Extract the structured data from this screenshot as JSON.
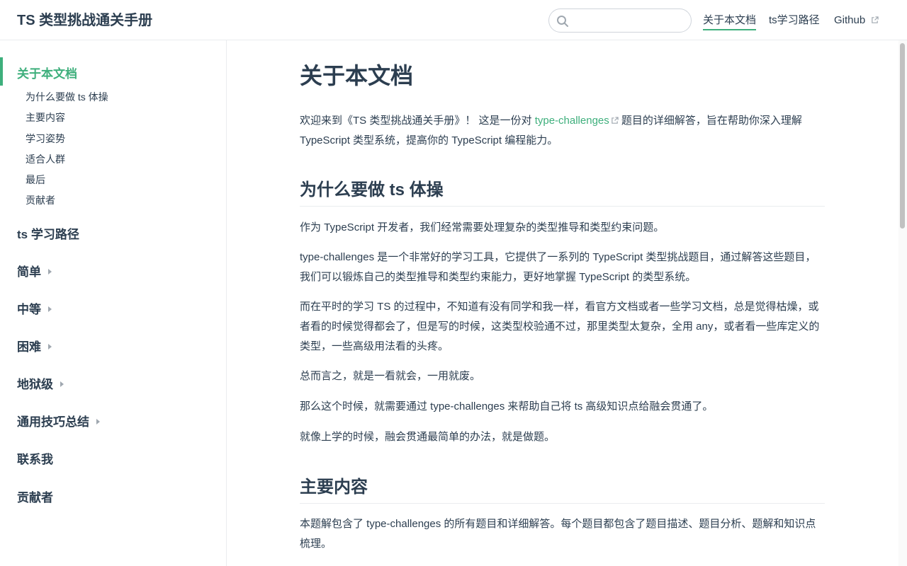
{
  "navbar": {
    "site_title": "TS 类型挑战通关手册",
    "search": {
      "value": "",
      "placeholder": ""
    },
    "links": [
      {
        "label": "关于本文档",
        "active": true
      },
      {
        "label": "ts学习路径",
        "active": false
      },
      {
        "label": "Github",
        "active": false,
        "external": true
      }
    ]
  },
  "sidebar": {
    "active_group": "关于本文档",
    "sub_items": [
      "为什么要做 ts 体操",
      "主要内容",
      "学习姿势",
      "适合人群",
      "最后",
      "贡献者"
    ],
    "groups": [
      {
        "label": "ts 学习路径",
        "collapsible": false
      },
      {
        "label": "简单",
        "collapsible": true
      },
      {
        "label": "中等",
        "collapsible": true
      },
      {
        "label": "困难",
        "collapsible": true
      },
      {
        "label": "地狱级",
        "collapsible": true
      },
      {
        "label": "通用技巧总结",
        "collapsible": true
      },
      {
        "label": "联系我",
        "collapsible": false
      },
      {
        "label": "贡献者",
        "collapsible": false
      }
    ]
  },
  "content": {
    "title": "关于本文档",
    "intro": {
      "before": "欢迎来到《TS 类型挑战通关手册》！ 这是一份对 ",
      "link": "type-challenges",
      "after": " 题目的详细解答，旨在帮助你深入理解 TypeScript 类型系统，提高你的 TypeScript 编程能力。"
    },
    "section1": {
      "heading": "为什么要做 ts 体操",
      "paragraphs": [
        "作为 TypeScript 开发者，我们经常需要处理复杂的类型推导和类型约束问题。",
        "type-challenges 是一个非常好的学习工具，它提供了一系列的 TypeScript 类型挑战题目，通过解答这些题目，我们可以锻炼自己的类型推导和类型约束能力，更好地掌握 TypeScript 的类型系统。",
        "而在平时的学习 TS 的过程中，不知道有没有同学和我一样，看官方文档或者一些学习文档，总是觉得枯燥，或者看的时候觉得都会了，但是写的时候，这类型校验通不过，那里类型太复杂，全用 any，或者看一些库定义的类型，一些高级用法看的头疼。",
        "总而言之，就是一看就会，一用就废。",
        "那么这个时候，就需要通过 type-challenges 来帮助自己将 ts 高级知识点给融会贯通了。",
        "就像上学的时候，融会贯通最简单的办法，就是做题。"
      ]
    },
    "section2": {
      "heading": "主要内容",
      "paragraphs": [
        "本题解包含了 type-challenges 的所有题目和详细解答。每个题目都包含了题目描述、题目分析、题解和知识点梳理。"
      ]
    }
  },
  "colors": {
    "accent": "#3eaf7c",
    "text": "#2c3e50",
    "border": "#eaecef"
  },
  "icons": {
    "search": "search-icon",
    "external": "external-link-icon",
    "expand": "chevron-right-icon"
  }
}
